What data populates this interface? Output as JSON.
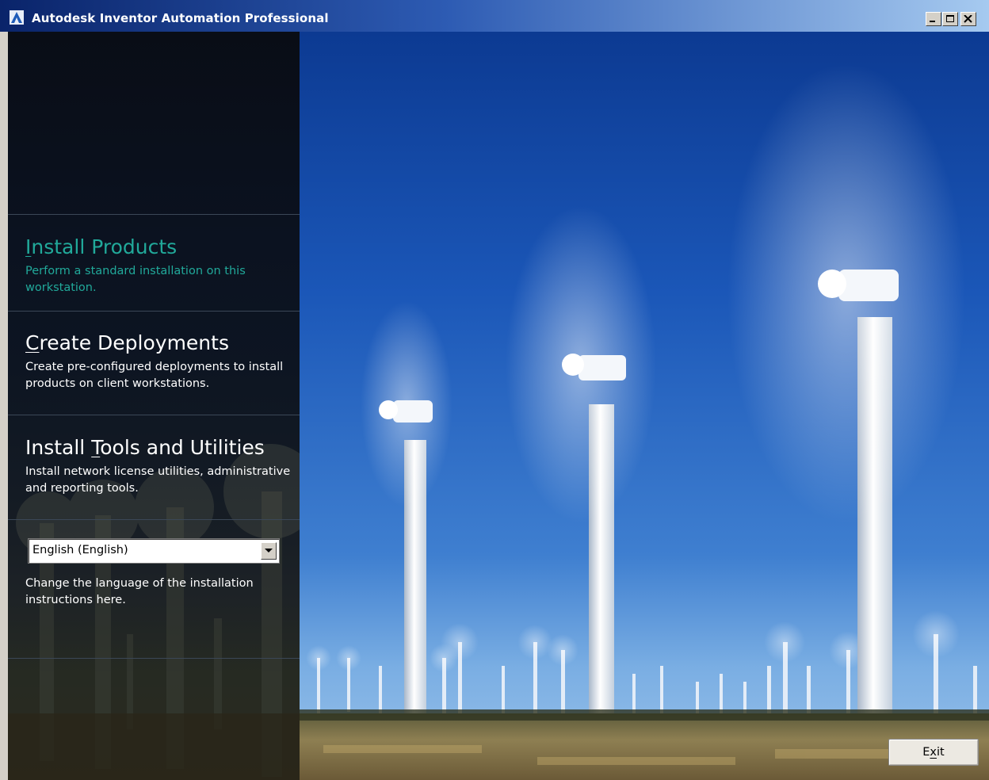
{
  "window": {
    "title": "Autodesk Inventor Automation Professional",
    "app_icon": "autodesk-logo-icon",
    "controls": [
      "minimize-icon",
      "maximize-icon",
      "close-icon"
    ]
  },
  "menu": {
    "items": [
      {
        "prefix": "",
        "accel": "I",
        "rest": "nstall Products",
        "description": "Perform a standard installation on this workstation.",
        "active": true
      },
      {
        "prefix": "",
        "accel": "C",
        "rest": "reate Deployments",
        "description": "Create pre-configured deployments to install products on client workstations.",
        "active": false
      },
      {
        "prefix": "Install ",
        "accel": "T",
        "rest": "ools and Utilities",
        "description": "Install network license utilities, administrative and reporting tools.",
        "active": false
      }
    ]
  },
  "language": {
    "selected": "English (English)",
    "help_text": "Change the language of the installation instructions here."
  },
  "footer": {
    "exit_prefix": "E",
    "exit_accel": "x",
    "exit_rest": "it"
  },
  "colors": {
    "active_menu": "#21a99a",
    "sidebar_bg": "#0b1220",
    "sky_top": "#0f3f9a",
    "sky_bottom": "#6fa2de"
  }
}
